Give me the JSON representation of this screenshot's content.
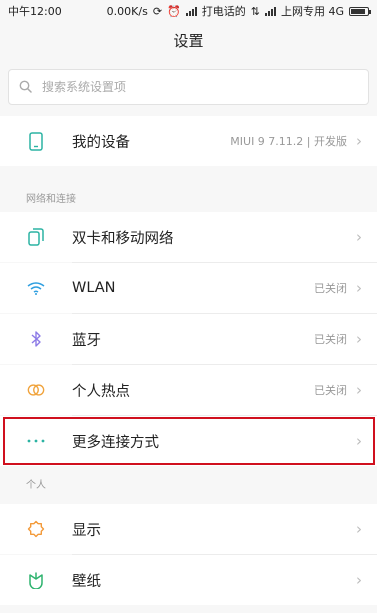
{
  "status_bar": {
    "time": "中午12:00",
    "speed": "0.00K/s",
    "call_label": "打电话的",
    "carrier": "上网专用 4G"
  },
  "page_title": "设置",
  "search": {
    "placeholder": "搜索系统设置项"
  },
  "device_row": {
    "label": "我的设备",
    "value": "MIUI 9 7.11.2 | 开发版"
  },
  "network_section": {
    "header": "网络和连接",
    "items": [
      {
        "label": "双卡和移动网络",
        "value": "",
        "icon": "sim-card-icon"
      },
      {
        "label": "WLAN",
        "value": "已关闭",
        "icon": "wifi-icon"
      },
      {
        "label": "蓝牙",
        "value": "已关闭",
        "icon": "bluetooth-icon"
      },
      {
        "label": "个人热点",
        "value": "已关闭",
        "icon": "hotspot-icon"
      },
      {
        "label": "更多连接方式",
        "value": "",
        "icon": "more-dots-icon"
      }
    ]
  },
  "personal_section": {
    "header": "个人",
    "items": [
      {
        "label": "显示",
        "value": "",
        "icon": "brightness-icon"
      },
      {
        "label": "壁纸",
        "value": "",
        "icon": "wallpaper-icon"
      }
    ]
  },
  "colors": {
    "accent_teal": "#2bb3a3",
    "highlight_red": "#d0101e",
    "wifi_blue": "#2f9fe0",
    "bluetooth_purple": "#8c7ae6",
    "hotspot_orange": "#f0a33c",
    "display_orange": "#f39a3a",
    "wallpaper_green": "#2fb36f"
  }
}
